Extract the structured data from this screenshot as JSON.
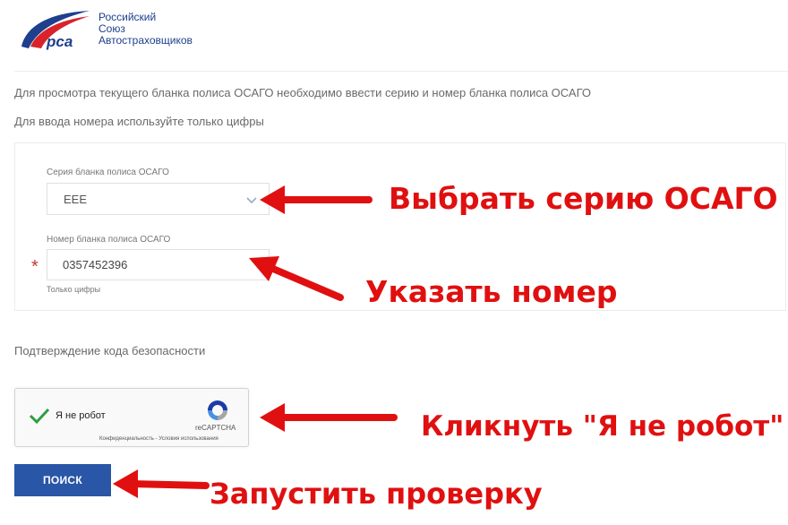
{
  "logo": {
    "mark": "рса",
    "line1": "Российский",
    "line2": "Союз",
    "line3": "Автостраховщиков",
    "brand_color": "#1d3f8c",
    "accent_color": "#d8232a"
  },
  "instructions": {
    "line1": "Для просмотра текущего бланка полиса ОСАГО необходимо ввести серию и номер бланка полиса ОСАГО",
    "line2": "Для ввода номера используйте только цифры"
  },
  "form": {
    "series_label": "Серия бланка полиса ОСАГО",
    "series_value": "ЕЕЕ",
    "number_label": "Номер бланка полиса ОСАГО",
    "number_value": "0357452396",
    "required_mark": "*",
    "number_hint": "Только цифры"
  },
  "captcha": {
    "title": "Подтверждение кода безопасности",
    "checkbox_label": "Я не робот",
    "brand": "reCAPTCHA",
    "links": "Конфиденциальность - Условия использования",
    "checked": true
  },
  "search_button": {
    "label": "ПОИСК",
    "color": "#2a56a7"
  },
  "annotations": {
    "color": "#e01010",
    "select_series": "Выбрать серию ОСАГО",
    "enter_number": "Указать номер",
    "click_robot": "Кликнуть \"Я не робот\"",
    "run_check": "Запустить проверку"
  }
}
